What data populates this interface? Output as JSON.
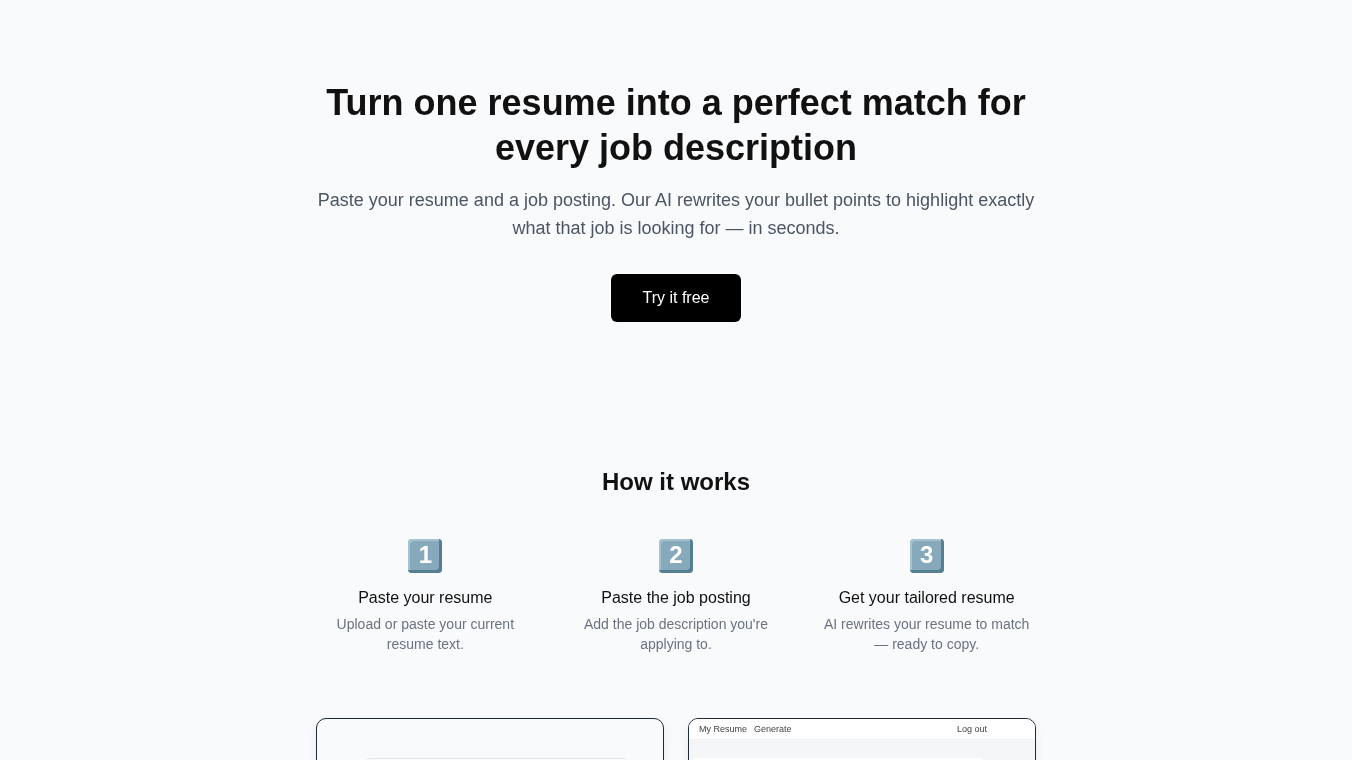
{
  "hero": {
    "title": "Turn one resume into a perfect match for every job description",
    "subtitle": "Paste your resume and a job posting. Our AI rewrites your bullet points to highlight exactly what that job is looking for — in seconds.",
    "cta": "Try it free"
  },
  "how_it_works": {
    "title": "How it works",
    "steps": [
      {
        "number": "1",
        "title": "Paste your resume",
        "description": "Upload or paste your current resume text."
      },
      {
        "number": "2",
        "title": "Paste the job posting",
        "description": "Add the job description you're applying to."
      },
      {
        "number": "3",
        "title": "Get your tailored resume",
        "description": "AI rewrites your resume to match — ready to copy."
      }
    ]
  },
  "previews": [
    {
      "kind": "blank"
    },
    {
      "kind": "app",
      "nav": [
        "My Resume",
        "Generate"
      ],
      "action": "Log out"
    }
  ]
}
